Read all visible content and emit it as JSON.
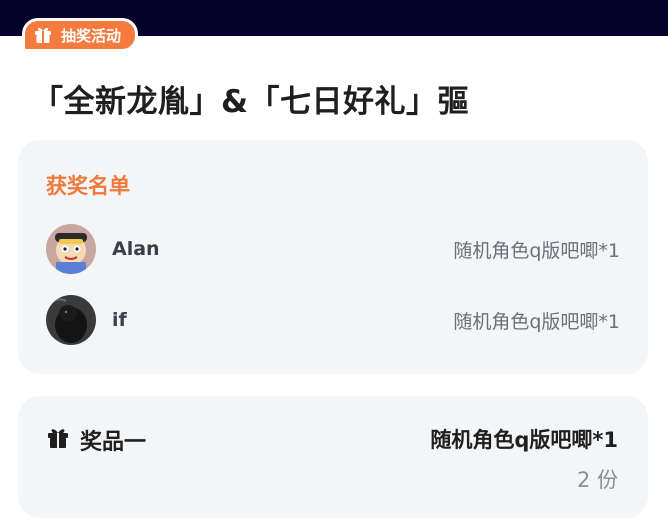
{
  "tag": {
    "label": "抽奖活动",
    "icon": "gift-icon",
    "color": "#f47a3d"
  },
  "title": "「全新龙胤」&「七日好礼」彄",
  "winners": {
    "heading": "获奖名单",
    "items": [
      {
        "name": "Alan",
        "prize": "随机角色q版吧唧*1",
        "avatar": "cartoon-avatar"
      },
      {
        "name": "if",
        "prize": "随机角色q版吧唧*1",
        "avatar": "dark-photo-avatar"
      }
    ]
  },
  "prize": {
    "icon": "gift-icon",
    "label": "奖品一",
    "name": "随机角色q版吧唧*1",
    "quantity": "2 份"
  },
  "colors": {
    "accent": "#ef7a3c",
    "header_bar": "#06012a",
    "card_bg": "#f4f5f7"
  }
}
